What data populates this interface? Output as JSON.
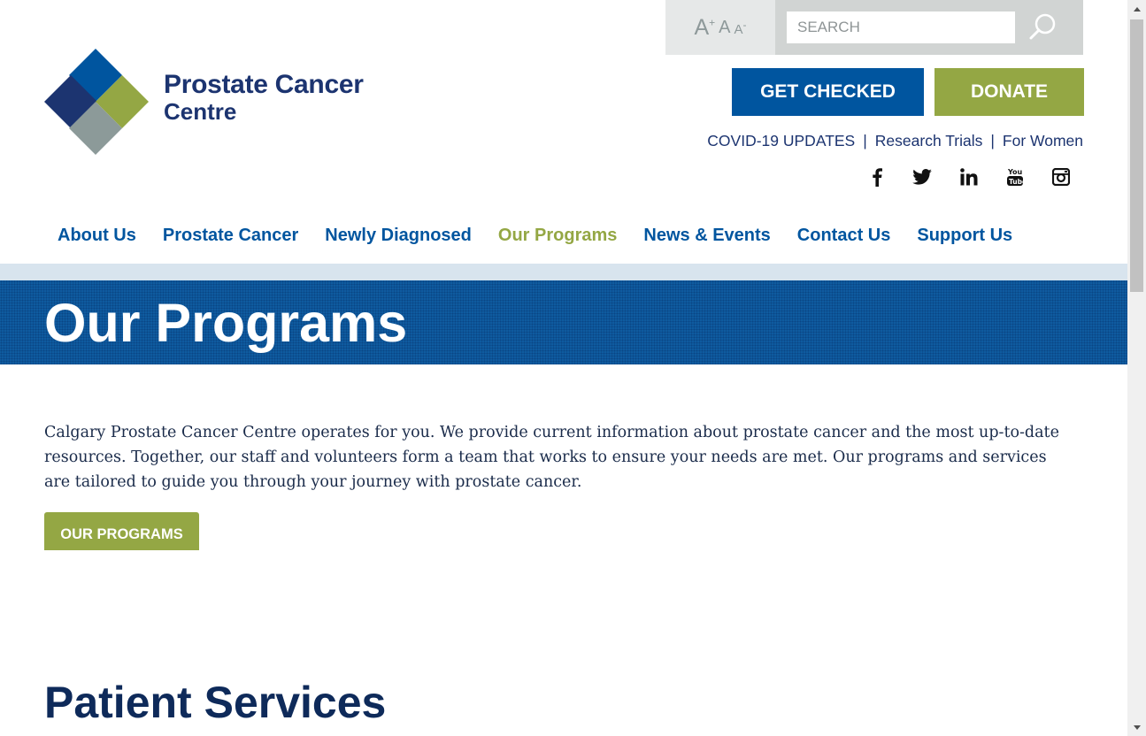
{
  "logo": {
    "line1": "Prostate Cancer",
    "line2": "Centre",
    "colors": [
      "#1c3470",
      "#00559f",
      "#94a744",
      "#8c9a99"
    ]
  },
  "font_size": {
    "large": "A",
    "large_sup": "+",
    "medium": "A",
    "small": "A",
    "small_sup": "-"
  },
  "search": {
    "placeholder": "SEARCH",
    "icon": "search-icon"
  },
  "cta": {
    "get_checked": "GET CHECKED",
    "donate": "DONATE"
  },
  "util_links": {
    "covid": "COVID-19 UPDATES",
    "sep": "|",
    "research": "Research Trials",
    "women": "For Women"
  },
  "social": {
    "facebook": "facebook-icon",
    "twitter": "twitter-icon",
    "linkedin": "linkedin-icon",
    "youtube": "youtube-icon",
    "instagram": "instagram-icon"
  },
  "nav": {
    "items": [
      "About Us",
      "Prostate Cancer",
      "Newly Diagnosed",
      "Our Programs",
      "News & Events",
      "Contact Us",
      "Support Us"
    ],
    "active": "Our Programs"
  },
  "banner": {
    "title": "Our Programs"
  },
  "intro": {
    "text": "Calgary Prostate Cancer Centre operates for you. We provide current information about prostate cancer and the most up-to-date resources. Together, our staff and volunteers form a team that works to ensure your needs are met. Our programs and services are tailored to guide you through your journey with prostate cancer."
  },
  "button_our_programs": "OUR PROGRAMS",
  "section": {
    "title": "Patient Services"
  },
  "colors": {
    "brand_blue": "#00559f",
    "brand_green": "#94a744",
    "navy": "#1c3470"
  }
}
